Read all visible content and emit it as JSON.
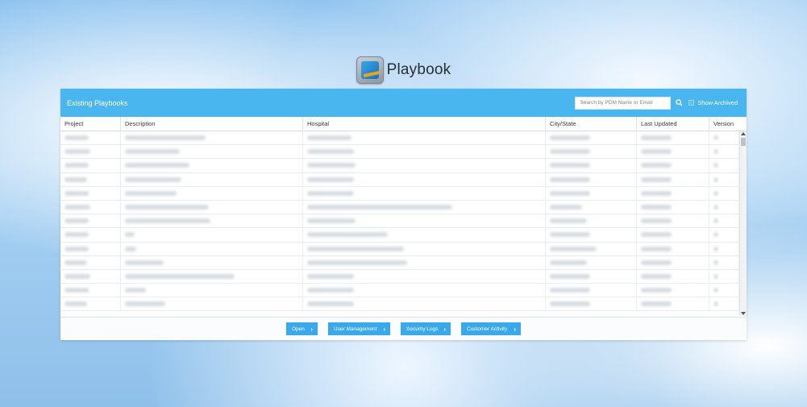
{
  "app": {
    "title": "Playbook"
  },
  "panel": {
    "title": "Existing Playbooks",
    "search_placeholder": "Search by PDM Name or Email",
    "show_archived_label": "Show Archived"
  },
  "table": {
    "columns": [
      "Project",
      "Description",
      "Hospital",
      "City/State",
      "Last Updated",
      "Version"
    ],
    "rows_visible": 13
  },
  "footer": {
    "buttons": [
      "Open",
      "User Management",
      "Security Logs",
      "Customer Activity"
    ]
  },
  "colors": {
    "header_bg": "#49b6f0",
    "button_bg": "#3aa9ec"
  }
}
